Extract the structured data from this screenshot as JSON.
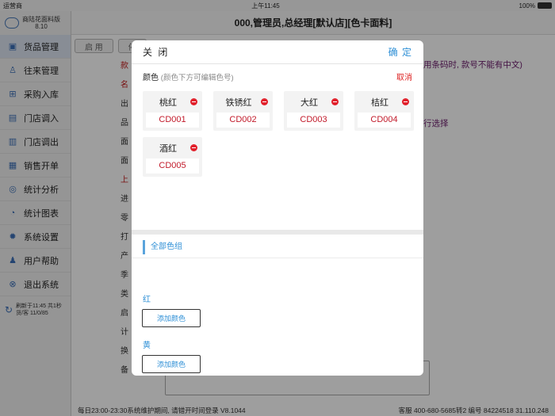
{
  "status_bar": {
    "carrier": "运营商",
    "time": "上午11:45",
    "battery": "100%"
  },
  "sidebar": {
    "app_name": "商陆花面料版",
    "version": "8.10",
    "items": [
      {
        "label": "货品管理",
        "icon": "box-icon"
      },
      {
        "label": "往来管理",
        "icon": "person-icon"
      },
      {
        "label": "采购入库",
        "icon": "cart-icon"
      },
      {
        "label": "门店调入",
        "icon": "store-in-icon"
      },
      {
        "label": "门店调出",
        "icon": "store-out-icon"
      },
      {
        "label": "销售开单",
        "icon": "receipt-icon"
      },
      {
        "label": "统计分析",
        "icon": "analysis-icon"
      },
      {
        "label": "统计图表",
        "icon": "chart-icon"
      },
      {
        "label": "系统设置",
        "icon": "gear-icon"
      },
      {
        "label": "用户帮助",
        "icon": "help-icon"
      },
      {
        "label": "退出系统",
        "icon": "exit-icon"
      }
    ],
    "refresh_line1": "刷新于11:45 共1秒",
    "refresh_line2": "货/客 11/0/85"
  },
  "header": {
    "title": "000,管理员,总经理[默认店][色卡面料]"
  },
  "background": {
    "toolbar_buttons": [
      "启 用",
      "停"
    ],
    "labels": [
      "款",
      "名",
      "出",
      "品",
      "面",
      "面",
      "上",
      "进",
      "零",
      "打",
      "产",
      "季",
      "类",
      "启",
      "计",
      "换",
      "备"
    ],
    "right_text_1": "用条码时, 款号不能有中文)",
    "right_text_2": "行选择"
  },
  "footer": {
    "left": "每日23:00-23:30系统维护期间, 请错开时间登录  V8.1044",
    "right": "客服 400-680-5685转2   编号 84224518  31.110.248"
  },
  "modal": {
    "close_label": "关 闭",
    "confirm_label": "确 定",
    "color_title": "颜色",
    "color_hint": "(颜色下方可编辑色号)",
    "cancel_label": "取消",
    "colors": [
      {
        "name": "桃红",
        "code": "CD001"
      },
      {
        "name": "铁锈红",
        "code": "CD002"
      },
      {
        "name": "大红",
        "code": "CD003"
      },
      {
        "name": "桔红",
        "code": "CD004"
      },
      {
        "name": "酒红",
        "code": "CD005"
      }
    ],
    "group_tab": "全部色组",
    "groups": [
      {
        "label": "红",
        "button": "添加颜色"
      },
      {
        "label": "黄",
        "button": "添加颜色"
      }
    ]
  }
}
